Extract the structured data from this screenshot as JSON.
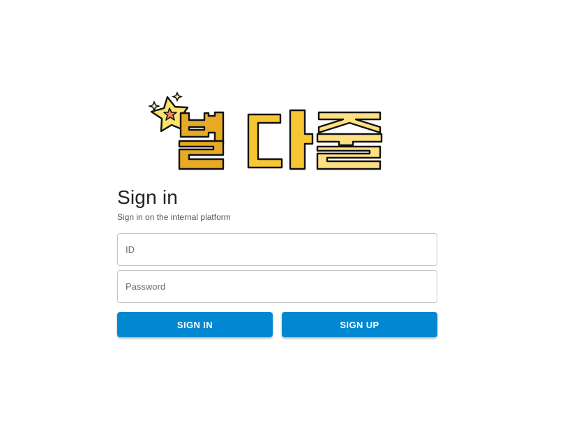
{
  "logo": {
    "text": "별다줄",
    "colors": {
      "star_outer": "#fce36b",
      "star_inner": "#f2845a",
      "char1": "#e8aa25",
      "char2": "#f7c733",
      "char3": "#fde080",
      "outline": "#111111"
    }
  },
  "signin": {
    "title": "Sign in",
    "subtitle": "Sign in on the internal platform",
    "id_placeholder": "ID",
    "password_placeholder": "Password",
    "signin_label": "SIGN IN",
    "signup_label": "SIGN UP"
  },
  "theme": {
    "primary": "#0288d1",
    "border": "#c4c4c4",
    "text": "#212121"
  }
}
